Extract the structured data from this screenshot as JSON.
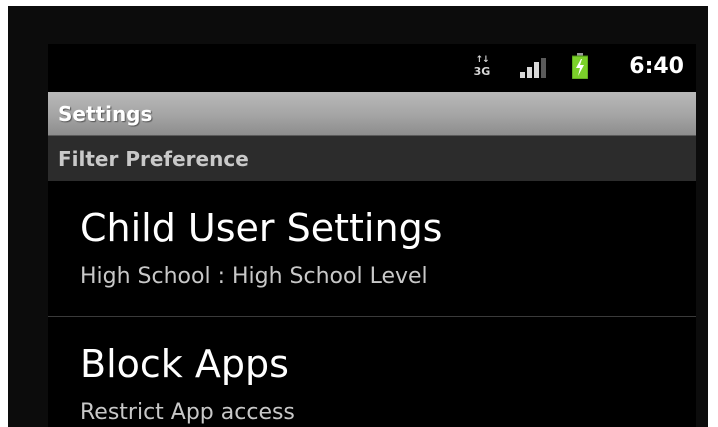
{
  "status_bar": {
    "network_type": "3G",
    "network_arrows": "↑↓",
    "time": "6:40",
    "icons": [
      "network-3g-icon",
      "signal-icon",
      "battery-charging-icon"
    ],
    "battery_color": "#7bd12a"
  },
  "title_bar": {
    "title": "Settings"
  },
  "category": {
    "title": "Filter Preference"
  },
  "preferences": [
    {
      "title": "Child User Settings",
      "summary": "High School : High School Level"
    },
    {
      "title": "Block Apps",
      "summary": "Restrict App access"
    }
  ]
}
